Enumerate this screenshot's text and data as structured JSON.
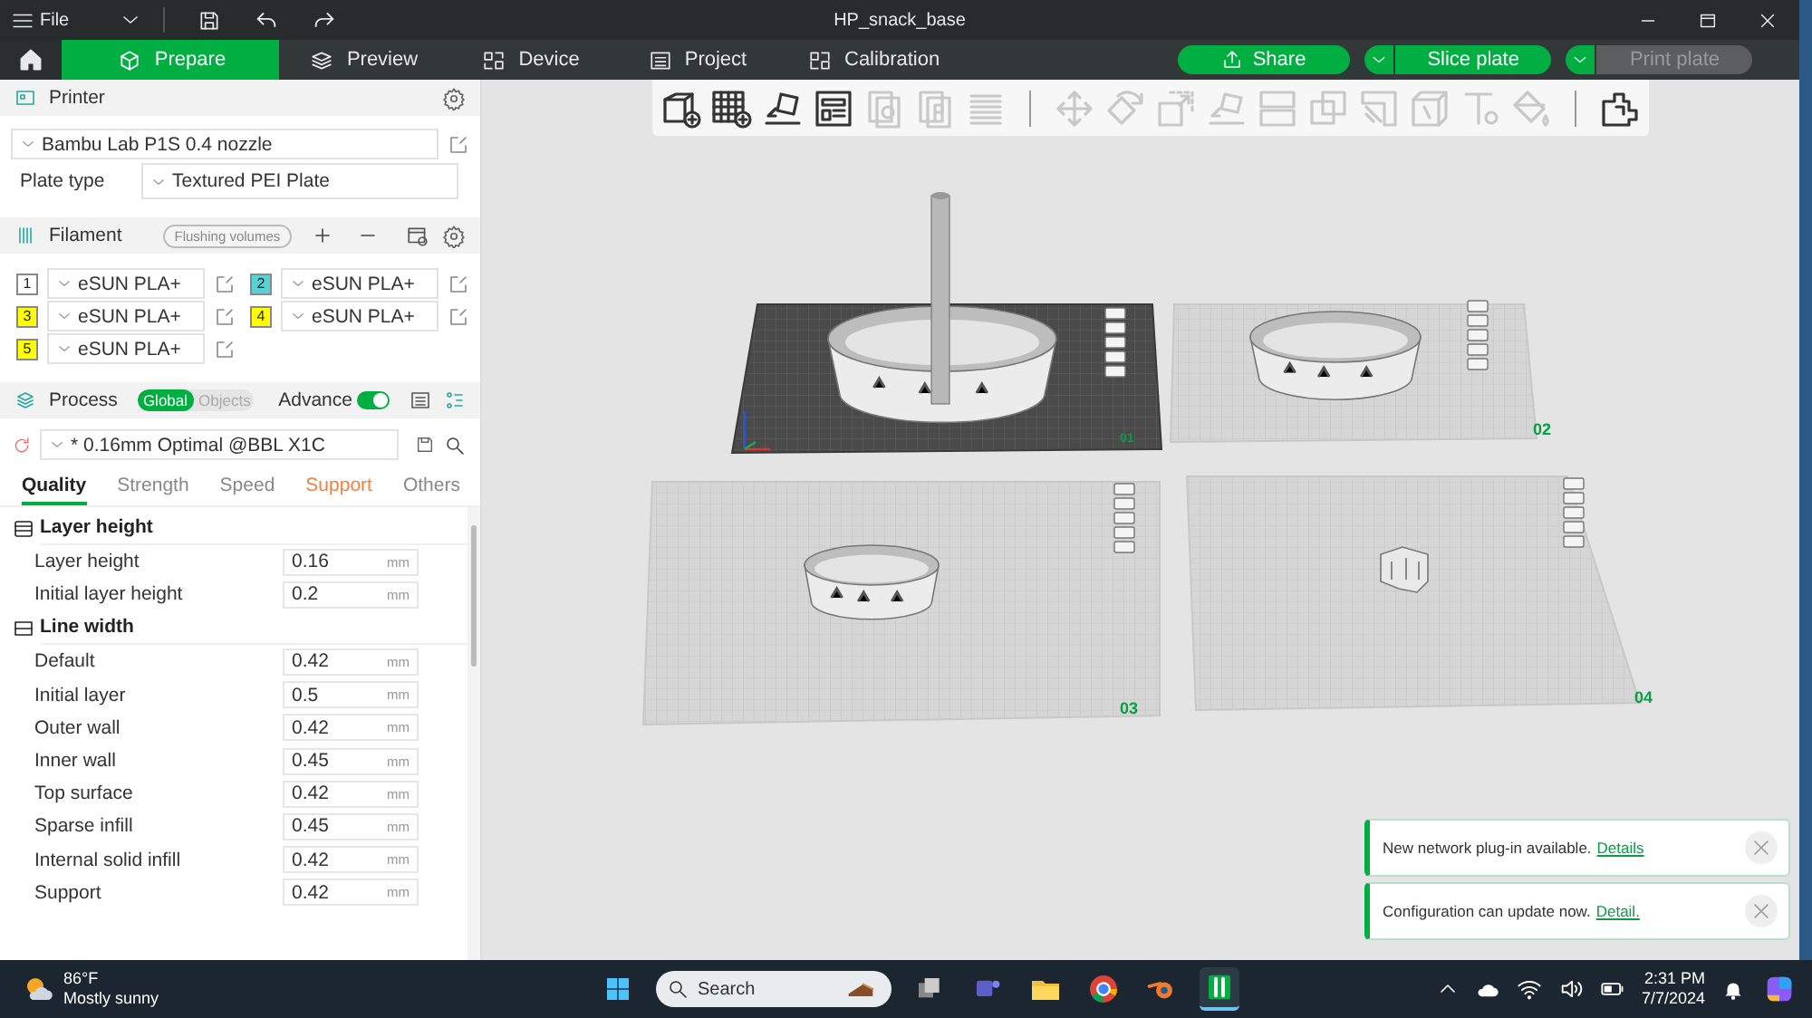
{
  "window": {
    "title": "HP_snack_base",
    "menu": "File"
  },
  "tabs": [
    {
      "label": "Prepare",
      "selected": true
    },
    {
      "label": "Preview",
      "selected": false
    },
    {
      "label": "Device",
      "selected": false
    },
    {
      "label": "Project",
      "selected": false
    },
    {
      "label": "Calibration",
      "selected": false
    }
  ],
  "actions": [
    {
      "label": "Share",
      "disabled": false
    },
    {
      "label": "Slice plate",
      "disabled": false
    },
    {
      "label": "Print plate",
      "disabled": true
    }
  ],
  "printer": {
    "title": "Printer",
    "preset": "Bambu Lab P1S 0.4 nozzle",
    "plate_label": "Plate type",
    "plate_value": "Textured PEI Plate"
  },
  "filament": {
    "title": "Filament",
    "flushing": "Flushing volumes",
    "items": [
      {
        "number": "1",
        "color": "#ffffff",
        "name": "eSUN PLA+"
      },
      {
        "number": "2",
        "color": "#56d3d6",
        "name": "eSUN PLA+"
      },
      {
        "number": "3",
        "color": "#ffff00",
        "name": "eSUN PLA+"
      },
      {
        "number": "4",
        "color": "#ffff00",
        "name": "eSUN PLA+"
      },
      {
        "number": "5",
        "color": "#ffff00",
        "name": "eSUN PLA+"
      }
    ]
  },
  "process": {
    "title": "Process",
    "scope": [
      {
        "label": "Global",
        "selected": true
      },
      {
        "label": "Objects",
        "selected": false
      }
    ],
    "advance": {
      "label": "Advance",
      "on": true
    },
    "preset": "* 0.16mm Optimal @BBL X1C"
  },
  "settings_tabs": [
    {
      "label": "Quality",
      "selected": true,
      "modified": false
    },
    {
      "label": "Strength",
      "selected": false,
      "modified": false
    },
    {
      "label": "Speed",
      "selected": false,
      "modified": false
    },
    {
      "label": "Support",
      "selected": false,
      "modified": true
    },
    {
      "label": "Others",
      "selected": false,
      "modified": false
    }
  ],
  "settings_groups": [
    {
      "kind": "layer",
      "title": "Layer height",
      "rows": [
        {
          "label": "Layer height",
          "value": "0.16",
          "unit": "mm"
        },
        {
          "label": "Initial layer height",
          "value": "0.2",
          "unit": "mm"
        }
      ]
    },
    {
      "kind": "line",
      "title": "Line width",
      "rows": [
        {
          "label": "Default",
          "value": "0.42",
          "unit": "mm"
        },
        {
          "label": "Initial layer",
          "value": "0.5",
          "unit": "mm"
        },
        {
          "label": "Outer wall",
          "value": "0.42",
          "unit": "mm"
        },
        {
          "label": "Inner wall",
          "value": "0.45",
          "unit": "mm"
        },
        {
          "label": "Top surface",
          "value": "0.42",
          "unit": "mm"
        },
        {
          "label": "Sparse infill",
          "value": "0.45",
          "unit": "mm"
        },
        {
          "label": "Internal solid infill",
          "value": "0.42",
          "unit": "mm"
        },
        {
          "label": "Support",
          "value": "0.42",
          "unit": "mm"
        }
      ]
    }
  ],
  "toolbar": [
    {
      "disabled": false
    },
    {
      "disabled": false
    },
    {
      "disabled": false
    },
    {
      "disabled": false
    },
    {
      "disabled": true
    },
    {
      "disabled": true
    },
    {
      "disabled": true
    },
    {
      "disabled": true
    },
    {
      "disabled": true
    },
    {
      "disabled": true
    },
    {
      "disabled": true
    },
    {
      "disabled": true
    },
    {
      "disabled": true
    },
    {
      "disabled": true
    },
    {
      "disabled": true
    },
    {
      "disabled": true
    },
    {
      "disabled": true
    },
    {
      "disabled": false
    }
  ],
  "plates": [
    {
      "label": "01",
      "selected": true
    },
    {
      "label": "02",
      "selected": false
    },
    {
      "label": "03",
      "selected": false
    },
    {
      "label": "04",
      "selected": false
    }
  ],
  "notifications": [
    {
      "text": "New network plug-in available.",
      "link": "Details"
    },
    {
      "text": "Configuration can update now.",
      "link": "Detail."
    }
  ],
  "taskbar": {
    "temperature": "86°F",
    "weather": "Mostly sunny",
    "search_placeholder": "Search",
    "time": "2:31 PM",
    "date": "7/7/2024"
  }
}
